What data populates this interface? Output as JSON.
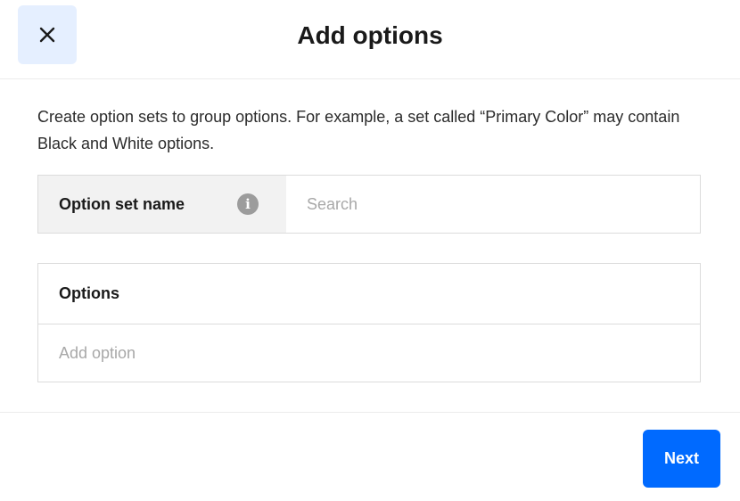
{
  "header": {
    "title": "Add options",
    "close_icon": "close-icon"
  },
  "description": "Create option sets to group options. For example, a set called “Primary Color” may contain Black and White options.",
  "option_set": {
    "label": "Option set name",
    "info_icon": "info-icon",
    "info_glyph": "i",
    "input_value": "",
    "placeholder": "Search"
  },
  "options": {
    "heading": "Options",
    "input_value": "",
    "placeholder": "Add option"
  },
  "footer": {
    "next_label": "Next"
  },
  "colors": {
    "primary": "#006aff",
    "close_bg": "#e5efff",
    "label_bg": "#f2f2f2",
    "border": "#dcdcdc",
    "info_icon": "#9c9c9c"
  }
}
